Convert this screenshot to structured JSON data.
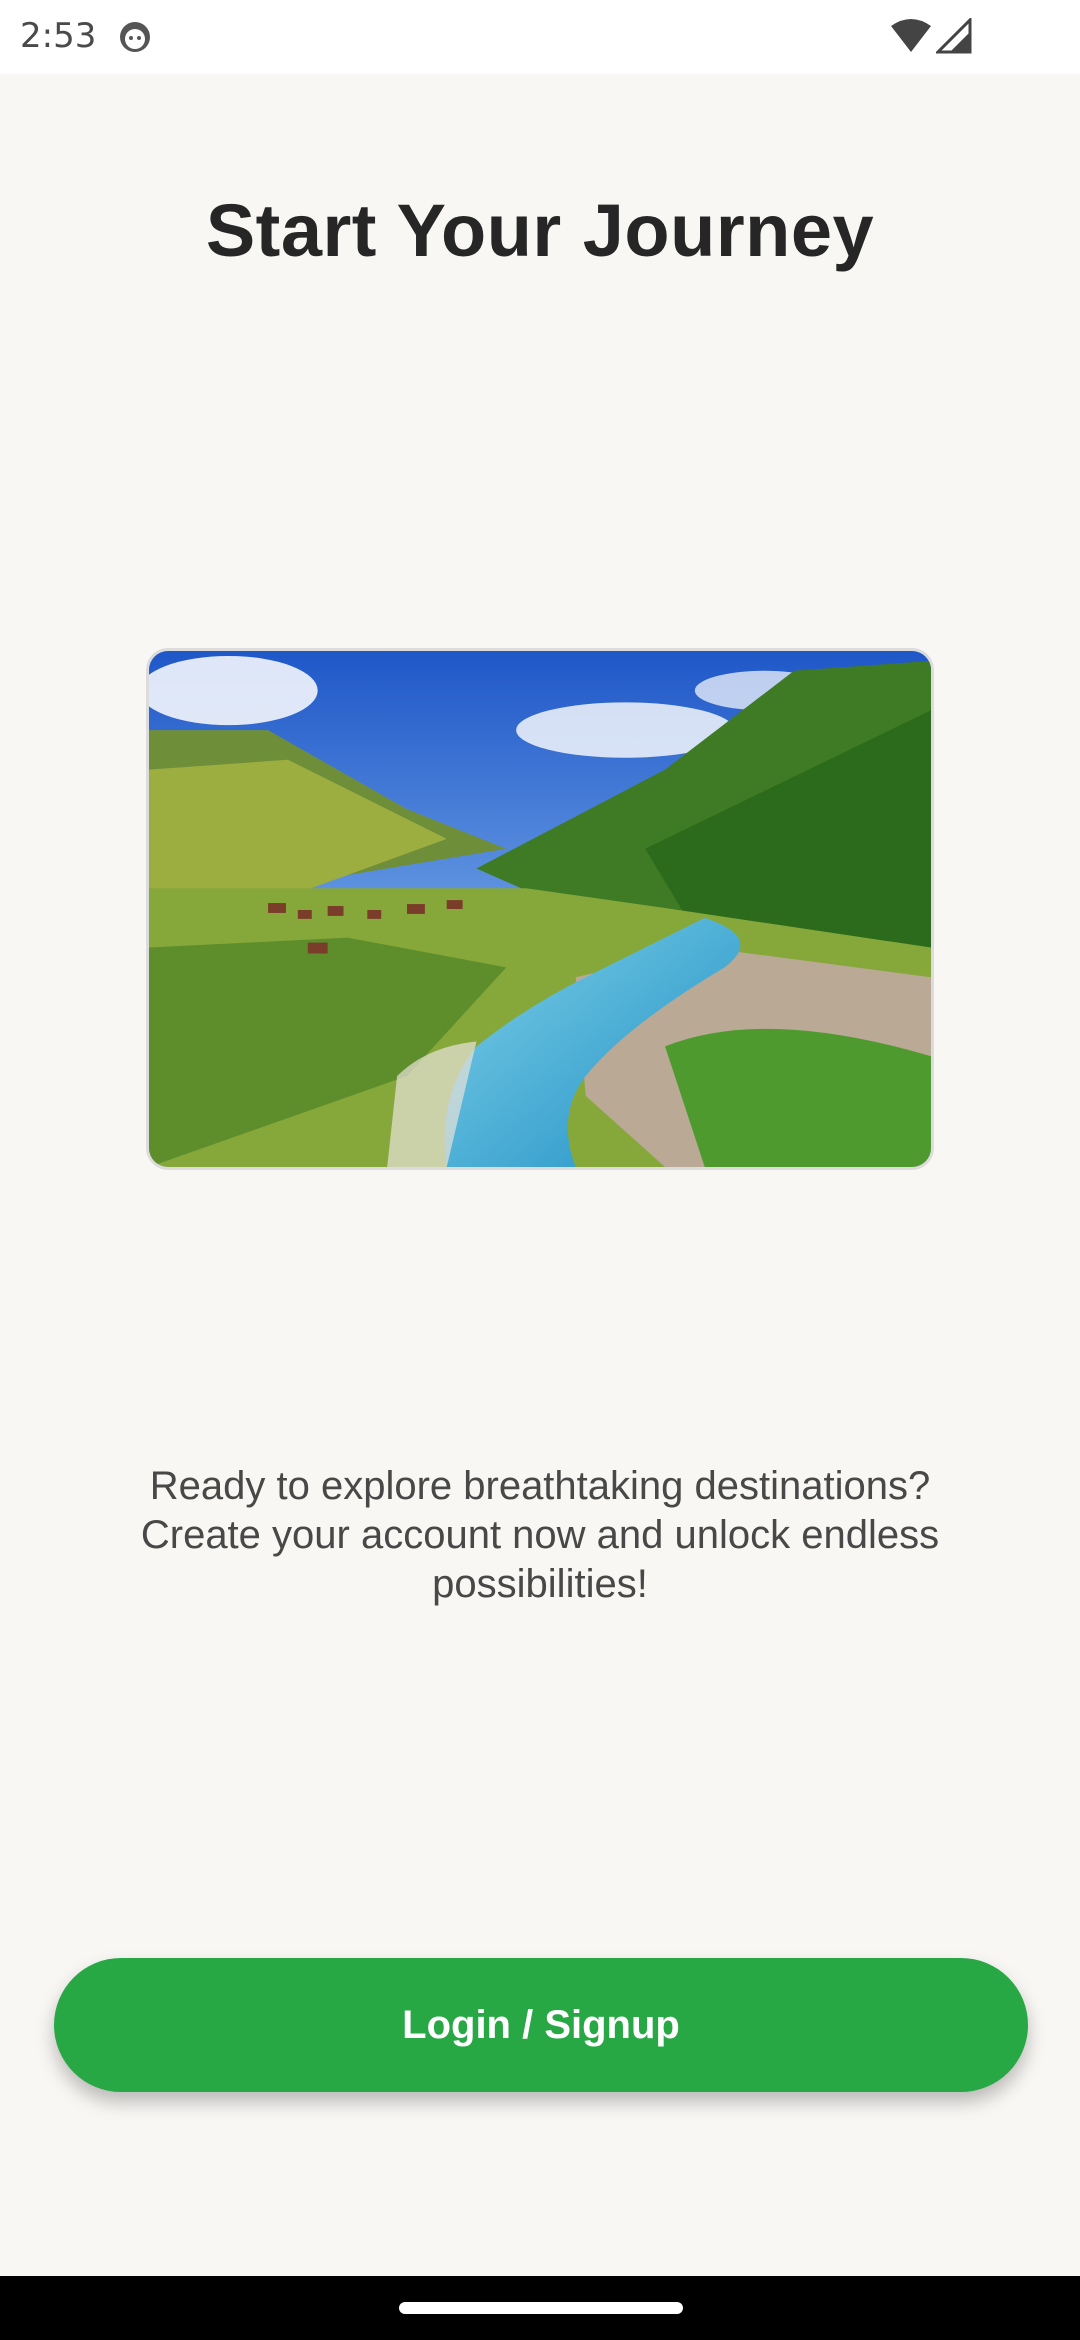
{
  "status_bar": {
    "time": "2:53",
    "app_icon": "android-face-icon",
    "wifi_icon": "wifi-icon",
    "signal_icon": "cell-signal-icon"
  },
  "screen": {
    "title": "Start Your Journey",
    "hero_image": "mountain-valley-river-landscape",
    "description": "Ready to explore breathtaking destinations? Create your account now and unlock endless possibilities!",
    "cta_label": "Login / Signup"
  },
  "colors": {
    "background": "#f8f7f4",
    "accent": "#28a745",
    "title_text": "#262626",
    "body_text": "#484848"
  }
}
